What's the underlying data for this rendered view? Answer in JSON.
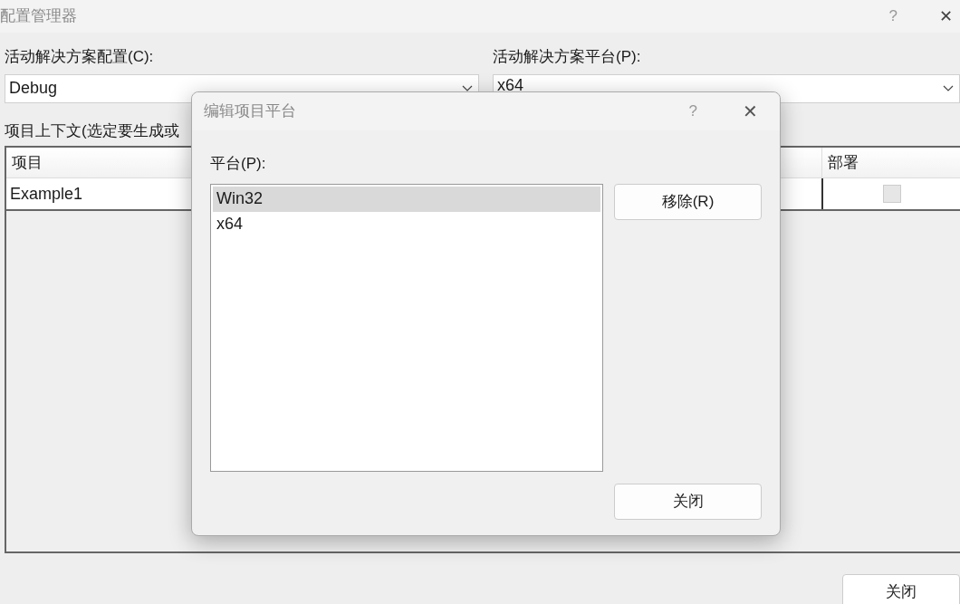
{
  "window": {
    "title": "配置管理器",
    "help": "?",
    "close": "✕"
  },
  "config": {
    "label": "活动解决方案配置(C):",
    "value": "Debug"
  },
  "platform": {
    "label": "活动解决方案平台(P):",
    "value": "x64"
  },
  "context_label": "项目上下文(选定要生成或",
  "table": {
    "columns": [
      "项目",
      "部署"
    ],
    "rows": [
      {
        "project": "Example1",
        "deploy": false
      }
    ]
  },
  "close_button": "关闭",
  "dialog": {
    "title": "编辑项目平台",
    "help": "?",
    "close": "✕",
    "list_label": "平台(P):",
    "platforms": [
      {
        "name": "Win32",
        "selected": true
      },
      {
        "name": "x64",
        "selected": false
      }
    ],
    "remove_button": "移除(R)",
    "close_button": "关闭"
  }
}
